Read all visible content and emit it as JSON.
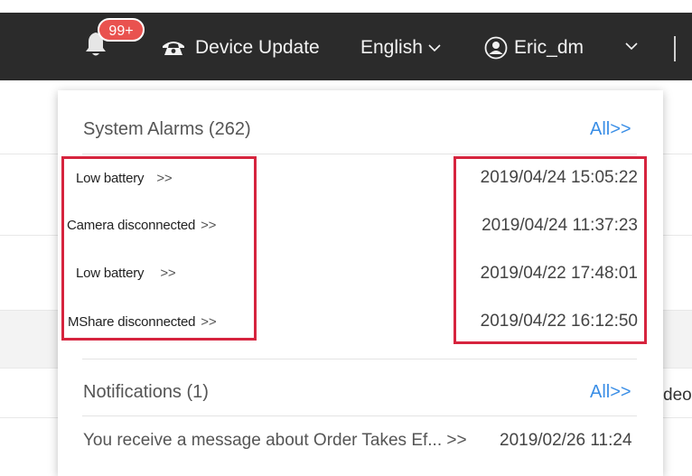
{
  "header": {
    "badge_count": "99+",
    "device_update_label": "Device Update",
    "language_label": "English",
    "user_label": "Eric_dm"
  },
  "system_alarms": {
    "title": "System Alarms (262)",
    "all_link": "All>>",
    "items": [
      {
        "name": "Low battery",
        "arrows": ">>",
        "time": "2019/04/24 15:05:22"
      },
      {
        "name": "Camera disconnected",
        "arrows": ">>",
        "time": "2019/04/24 11:37:23"
      },
      {
        "name": "Low battery",
        "arrows": ">>",
        "time": "2019/04/22 17:48:01"
      },
      {
        "name": "MShare disconnected",
        "arrows": ">>",
        "time": "2019/04/22 16:12:50"
      }
    ]
  },
  "notifications": {
    "title": "Notifications (1)",
    "all_link": "All>>",
    "items": [
      {
        "text": "You receive a message about Order Takes Ef... >>",
        "time": "2019/02/26 11:24"
      }
    ]
  },
  "background_page": {
    "partial_text": "deo"
  },
  "colors": {
    "topbar": "#2b2b2b",
    "badge": "#e9524f",
    "link": "#3a8ee6",
    "highlight_box": "#d6243e"
  },
  "icons": [
    "bell-icon",
    "phone-icon",
    "chevron-down-icon",
    "user-circle-icon"
  ]
}
